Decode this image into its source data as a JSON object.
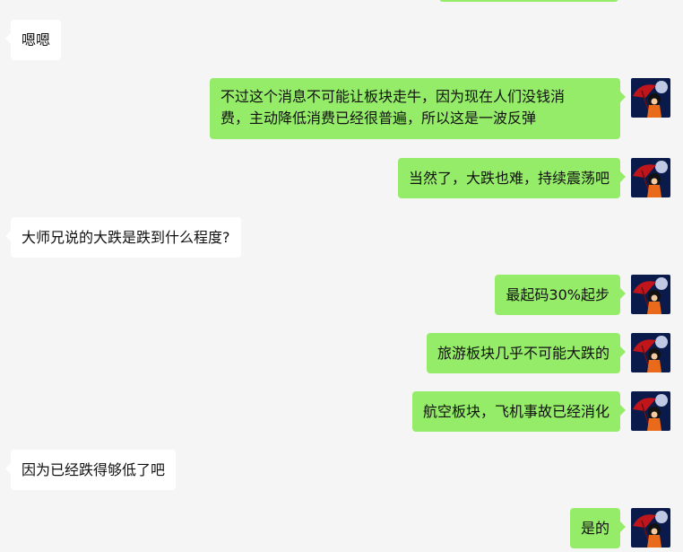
{
  "colors": {
    "background": "#f5f5f5",
    "incoming_bubble": "#ffffff",
    "outgoing_bubble": "#95ec69",
    "text": "#111111"
  },
  "messages": [
    {
      "side": "in",
      "text": "嗯嗯"
    },
    {
      "side": "out",
      "line1": "不过这个消息不可能让板块走牛，因为现在人们没钱消",
      "line2": "费，主动降低消费已经很普遍，所以这是一波反弹",
      "avatar": "user-avatar"
    },
    {
      "side": "out",
      "text": "当然了，大跌也难，持续震荡吧",
      "avatar": "user-avatar"
    },
    {
      "side": "in",
      "text": "大师兄说的大跌是跌到什么程度?"
    },
    {
      "side": "out",
      "text": "最起码30%起步",
      "avatar": "user-avatar"
    },
    {
      "side": "out",
      "text": "旅游板块几乎不可能大跌的",
      "avatar": "user-avatar"
    },
    {
      "side": "out",
      "text": "航空板块，飞机事故已经消化",
      "avatar": "user-avatar"
    },
    {
      "side": "in",
      "text": "因为已经跌得够低了吧"
    },
    {
      "side": "out",
      "text": "是的",
      "avatar": "user-avatar"
    }
  ]
}
